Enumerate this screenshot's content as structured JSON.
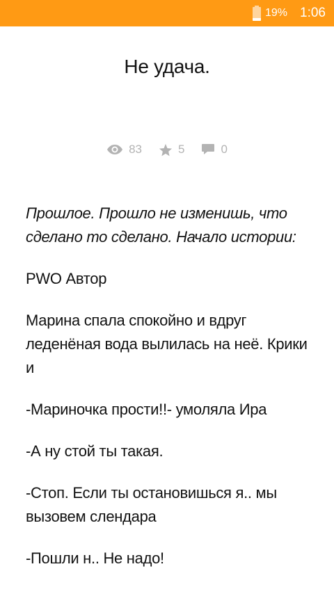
{
  "status_bar": {
    "battery_percent": "19%",
    "battery_level": 0.19,
    "time": "1:06",
    "color": "#ff9a14"
  },
  "story": {
    "title": "Не удача."
  },
  "stats": {
    "views": "83",
    "stars": "5",
    "comments": "0",
    "icons": [
      "eye-icon",
      "star-icon",
      "comment-icon"
    ]
  },
  "content": {
    "paragraphs": [
      "Прошлое. Прошло не изменишь, что сделано то сделано. Начало истории:",
      "PWO Автор",
      "Марина спала спокойно и вдруг леденёная вода вылилась на неё. Крики и",
      "-Мариночка прости!!- умоляла Ира",
      "-А ну стой ты такая.",
      "-Стоп. Если ты остановишься я.. мы вызовем слендара",
      "-Пошли н.. Не надо!"
    ]
  }
}
